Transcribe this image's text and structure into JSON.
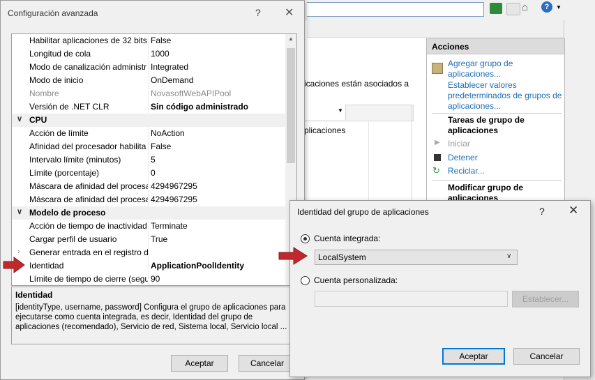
{
  "background_window": {
    "main_text": "icaciones están asociados a",
    "list_item": "plicaciones",
    "actions": {
      "header": "Acciones",
      "add_pool": [
        "Agregar grupo de",
        "aplicaciones..."
      ],
      "set_defaults": [
        "Establecer valores",
        "predeterminados de grupos de",
        "aplicaciones..."
      ],
      "tasks_header": [
        "Tareas de grupo de",
        "aplicaciones"
      ],
      "start": "Iniciar",
      "stop": "Detener",
      "recycle": "Reciclar...",
      "modify_header": [
        "Modificar grupo de",
        "aplicaciones"
      ]
    }
  },
  "advanced_dialog": {
    "title": "Configuración avanzada",
    "help": "?",
    "close": "✕",
    "rows": [
      {
        "name": "Habilitar aplicaciones de 32 bits",
        "value": "False"
      },
      {
        "name": "Longitud de cola",
        "value": "1000"
      },
      {
        "name": "Modo de canalización administr",
        "value": "Integrated"
      },
      {
        "name": "Modo de inicio",
        "value": "OnDemand"
      },
      {
        "name": "Nombre",
        "value": "NovasoftWebAPIPool"
      },
      {
        "name": "Versión de .NET CLR",
        "value": "Sin código administrado"
      },
      {
        "name": "CPU",
        "value": ""
      },
      {
        "name": "Acción de límite",
        "value": "NoAction"
      },
      {
        "name": "Afinidad del procesador habilita",
        "value": "False"
      },
      {
        "name": "Intervalo límite (minutos)",
        "value": "5"
      },
      {
        "name": "Límite (porcentaje)",
        "value": "0"
      },
      {
        "name": "Máscara de afinidad del procesa",
        "value": "4294967295"
      },
      {
        "name": "Máscara de afinidad del procesa",
        "value": "4294967295"
      },
      {
        "name": "Modelo de proceso",
        "value": ""
      },
      {
        "name": "Acción de tiempo de inactividad",
        "value": "Terminate"
      },
      {
        "name": "Cargar perfil de usuario",
        "value": "True"
      },
      {
        "name": "Generar entrada en el registro de",
        "value": ""
      },
      {
        "name": "Identidad",
        "value": "ApplicationPoolIdentity"
      },
      {
        "name": "Límite de tiempo de cierre (segu",
        "value": "90"
      }
    ],
    "desc_title": "Identidad",
    "desc_body": "[identityType, username, password] Configura el grupo de aplicaciones para ejecutarse como cuenta integrada, es decir, Identidad del grupo de aplicaciones (recomendado), Servicio de red, Sistema local, Servicio local ...",
    "ok": "Aceptar",
    "cancel": "Cancelar"
  },
  "identity_dialog": {
    "title": "Identidad del grupo de aplicaciones",
    "help": "?",
    "close": "✕",
    "builtin_label": "Cuenta integrada:",
    "builtin_value": "LocalSystem",
    "custom_label": "Cuenta personalizada:",
    "set_button": "Establecer...",
    "ok": "Aceptar",
    "cancel": "Cancelar"
  },
  "colors": {
    "arrow": "#c0282d",
    "link": "#1e6db5",
    "focus": "#0078d7"
  }
}
